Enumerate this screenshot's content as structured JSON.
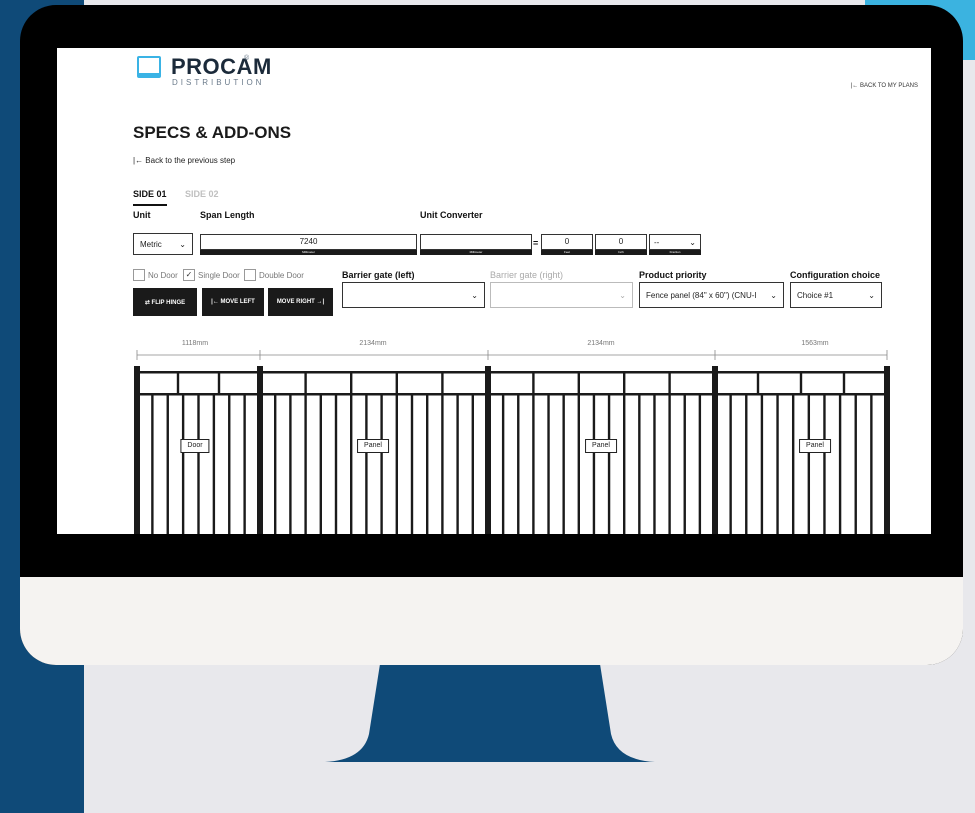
{
  "app": {
    "logo": {
      "name": "PROCAM",
      "sub": "DISTRIBUTION",
      "reg": "®"
    },
    "back_to_plans": "|← BACK TO MY PLANS",
    "title": "SPECS & ADD-ONS",
    "back_step": "|← Back to the previous step"
  },
  "tabs": [
    {
      "label": "SIDE 01",
      "active": true
    },
    {
      "label": "SIDE 02",
      "active": false
    }
  ],
  "form": {
    "unit": {
      "label": "Unit",
      "value": "Metric"
    },
    "span": {
      "label": "Span Length",
      "value": "7240",
      "unit": "Millimeter"
    },
    "converter": {
      "label": "Unit Converter",
      "mm_value": "",
      "mm_unit": "Millimeter",
      "feet_value": "0",
      "feet_unit": "Feet",
      "inch_value": "0",
      "inch_unit": "Inch",
      "fraction_value": "--",
      "fraction_unit": "Fraction",
      "equals": "="
    },
    "door_options": [
      {
        "label": "No Door",
        "checked": false
      },
      {
        "label": "Single Door",
        "checked": true
      },
      {
        "label": "Double Door",
        "checked": false
      }
    ],
    "barrier_left": {
      "label": "Barrier gate (left)",
      "value": ""
    },
    "barrier_right": {
      "label": "Barrier gate (right)",
      "value": ""
    },
    "product_priority": {
      "label": "Product priority",
      "value": "Fence panel (84\" x 60\") (CNU-I"
    },
    "configuration": {
      "label": "Configuration choice",
      "value": "Choice #1"
    },
    "buttons": {
      "flip": "⇄ FLIP HINGE",
      "left": "|← MOVE LEFT",
      "right": "MOVE RIGHT →|"
    }
  },
  "fence": {
    "sections": [
      {
        "dimension": "1118mm",
        "type": "Door"
      },
      {
        "dimension": "2134mm",
        "type": "Panel"
      },
      {
        "dimension": "2134mm",
        "type": "Panel"
      },
      {
        "dimension": "1563mm",
        "type": "Panel"
      }
    ]
  },
  "colors": {
    "monitor_bezel": "#000000",
    "chin": "#f5f3f1",
    "stand": "#0f4a78",
    "background": "#e8e8ec",
    "accent": "#3bb3e0",
    "fence": "#1a1a1a"
  }
}
